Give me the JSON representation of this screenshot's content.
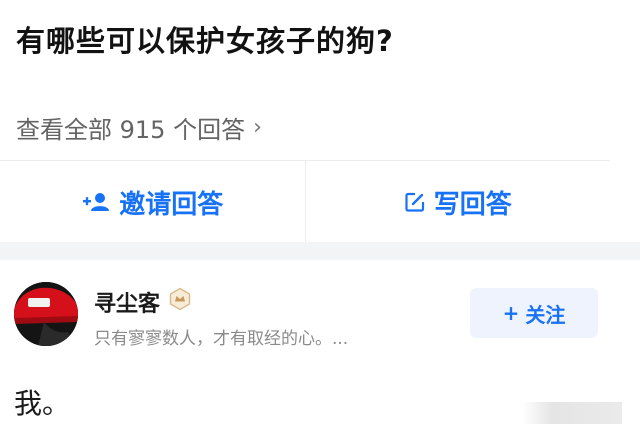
{
  "question": {
    "title": "有哪些可以保护女孩子的狗?"
  },
  "view_all": {
    "label": "查看全部 915 个回答",
    "chevron": "›"
  },
  "actions": {
    "invite": {
      "label": "邀请回答",
      "icon": "invite-person-icon"
    },
    "write": {
      "label": "写回答",
      "icon": "edit-icon"
    }
  },
  "answer": {
    "author": {
      "name": "寻尘客",
      "badge_icon": "creator-badge-icon",
      "bio": "只有寥寥数人，才有取经的心。..."
    },
    "follow": {
      "plus": "+",
      "label": "关注"
    },
    "text": "我。"
  },
  "colors": {
    "accent": "#1772f6",
    "muted": "#8a8a8a",
    "band": "#f3f4f6"
  }
}
